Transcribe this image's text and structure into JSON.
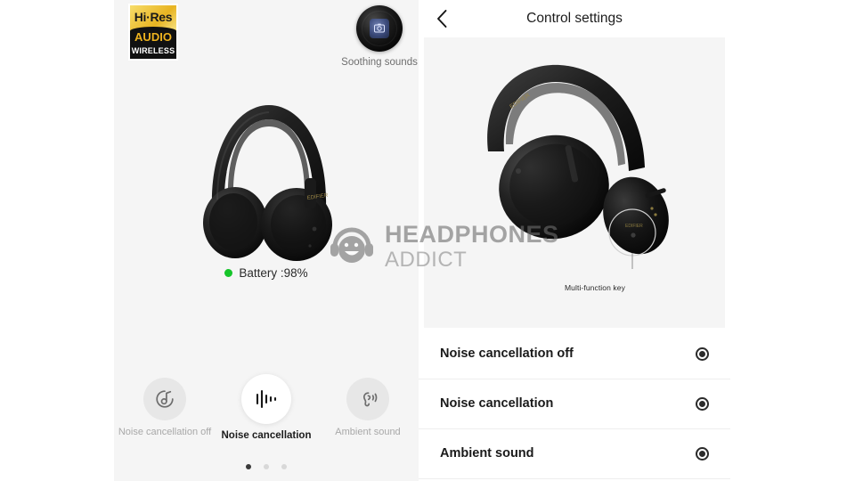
{
  "left_panel": {
    "hires_badge": {
      "line1": "Hi·Res",
      "line2": "AUDIO",
      "line3": "WIRELESS"
    },
    "soothing": {
      "label": "Soothing sounds",
      "icon": "vinyl-disc-icon"
    },
    "battery": {
      "text": "Battery :98%",
      "percent": 98,
      "dot_color": "#16c52a"
    },
    "modes": [
      {
        "label": "Noise cancellation off",
        "icon": "music-note-circle-icon",
        "selected": false
      },
      {
        "label": "Noise cancellation",
        "icon": "waveform-icon",
        "selected": true
      },
      {
        "label": "Ambient sound",
        "icon": "ear-waves-icon",
        "selected": false
      }
    ],
    "pager": {
      "count": 3,
      "active_index": 0
    }
  },
  "right_panel": {
    "header": {
      "back_icon": "chevron-left-icon",
      "title": "Control settings"
    },
    "hero": {
      "annotation_label": "Multi-function key",
      "product_alt": "black over-ear headphones"
    },
    "rows": [
      {
        "label": "Noise cancellation off",
        "control": "radio-button"
      },
      {
        "label": "Noise cancellation",
        "control": "radio-button"
      },
      {
        "label": "Ambient sound",
        "control": "radio-button"
      }
    ]
  },
  "watermark": {
    "line1": "HEADPHONES",
    "line2": "ADDICT",
    "logo": "headphones-smiley-logo"
  }
}
